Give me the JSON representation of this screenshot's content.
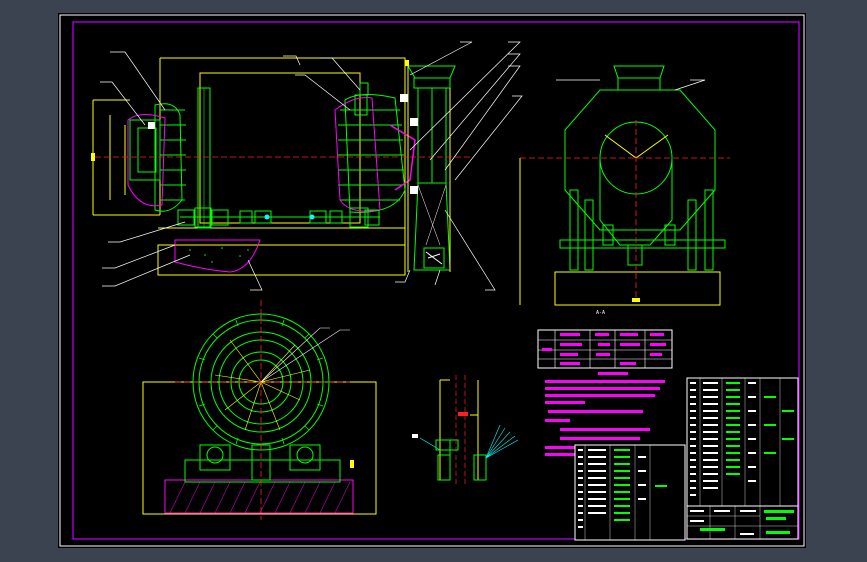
{
  "colors": {
    "background": "#3b4250",
    "paper": "#000000",
    "frame": "#ffffff",
    "border_inner": "#c000ff",
    "yellow": "#ffff00",
    "green": "#00ff00",
    "red": "#ff2020",
    "cyan": "#00ffff",
    "magenta": "#ff00ff",
    "white": "#ffffff"
  },
  "view_labels": {
    "side_view_caption": "A-A"
  }
}
